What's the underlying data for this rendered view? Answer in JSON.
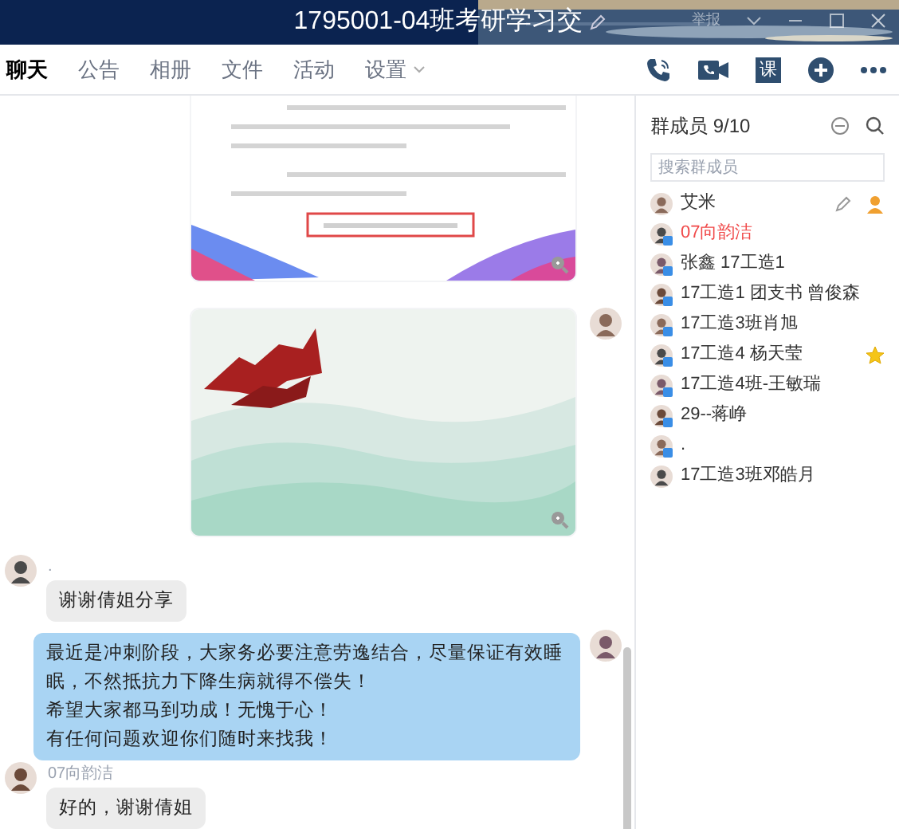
{
  "window": {
    "title": "1795001-04班考研学习交",
    "report": "举报"
  },
  "tabs": [
    {
      "label": "聊天",
      "selected": true,
      "dropdown": false
    },
    {
      "label": "公告",
      "selected": false,
      "dropdown": false
    },
    {
      "label": "相册",
      "selected": false,
      "dropdown": false
    },
    {
      "label": "文件",
      "selected": false,
      "dropdown": false
    },
    {
      "label": "活动",
      "selected": false,
      "dropdown": false
    },
    {
      "label": "设置",
      "selected": false,
      "dropdown": true
    }
  ],
  "toolbar": [
    {
      "kind": "phone"
    },
    {
      "kind": "video"
    },
    {
      "kind": "label",
      "text": "课"
    },
    {
      "kind": "add"
    },
    {
      "kind": "more"
    }
  ],
  "messages": [
    {
      "kind": "card-image",
      "outgoing": true,
      "avatar": false
    },
    {
      "kind": "landscape-image",
      "outgoing": true,
      "avatar": true
    },
    {
      "kind": "text",
      "outgoing": false,
      "avatar": true,
      "sender": ".",
      "lines": [
        "谢谢倩姐分享"
      ]
    },
    {
      "kind": "text",
      "outgoing": true,
      "avatar": true,
      "lines": [
        "最近是冲刺阶段，大家务必要注意劳逸结合，尽量保证有效睡眠，不然抵抗力下降生病就得不偿失！",
        "希望大家都马到功成！无愧于心！",
        "有任何问题欢迎你们随时来找我！"
      ]
    },
    {
      "kind": "text",
      "outgoing": false,
      "avatar": true,
      "sender": "07向韵洁",
      "lines": [
        "好的，谢谢倩姐"
      ]
    }
  ],
  "members": {
    "title": "群成员 9/10",
    "search": {
      "placeholder": "搜索群成员"
    },
    "items": [
      {
        "name": "艾米",
        "highlighted": false,
        "mobile": false,
        "owner": true,
        "starred": false
      },
      {
        "name": "07向韵洁",
        "highlighted": true,
        "mobile": true,
        "owner": false,
        "starred": false
      },
      {
        "name": "张鑫 17工造1",
        "highlighted": false,
        "mobile": true,
        "owner": false,
        "starred": false
      },
      {
        "name": "17工造1 团支书 曾俊森",
        "highlighted": false,
        "mobile": true,
        "owner": false,
        "starred": false
      },
      {
        "name": "17工造3班肖旭",
        "highlighted": false,
        "mobile": true,
        "owner": false,
        "starred": false
      },
      {
        "name": "17工造4 杨天莹",
        "highlighted": false,
        "mobile": true,
        "owner": false,
        "starred": true
      },
      {
        "name": "17工造4班-王敏瑞",
        "highlighted": false,
        "mobile": true,
        "owner": false,
        "starred": false
      },
      {
        "name": "29--蒋峥",
        "highlighted": false,
        "mobile": true,
        "owner": false,
        "starred": false
      },
      {
        "name": ".",
        "highlighted": false,
        "mobile": true,
        "owner": false,
        "starred": false
      },
      {
        "name": "17工造3班邓皓月",
        "highlighted": false,
        "mobile": false,
        "owner": false,
        "starred": false
      }
    ]
  }
}
